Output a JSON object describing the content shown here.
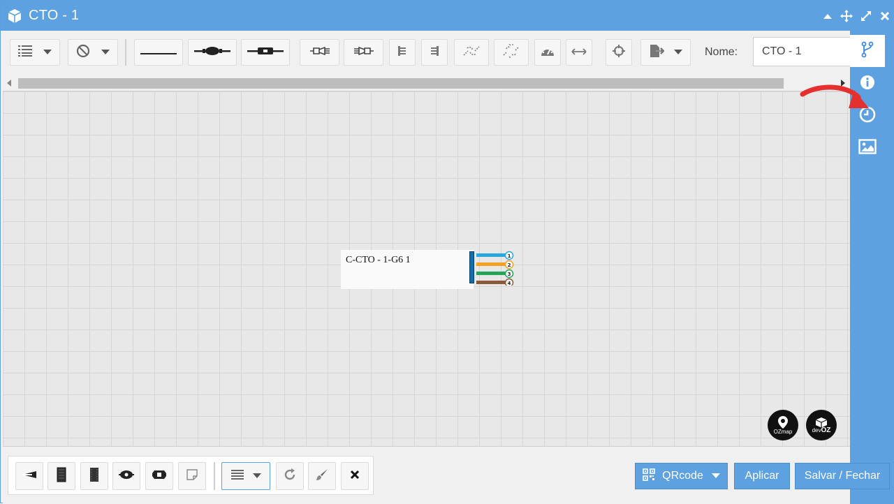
{
  "window": {
    "title": "CTO - 1",
    "title_icon": "cube-icon",
    "controls": [
      "collapse-up-icon",
      "move-icon",
      "expand-icon",
      "close-icon"
    ]
  },
  "toolbar": {
    "list_dropdown_icon": "list-icon",
    "block_dropdown_icon": "block-icon",
    "cable_icon": "cable-line-icon",
    "splice_icon": "splice-icon",
    "connector_icon": "connector-icon",
    "name_label": "Nome:",
    "name_value": "CTO - 1"
  },
  "sidebar": {
    "items": [
      "branch-icon",
      "info-icon",
      "clock-icon",
      "image-icon"
    ],
    "active": "branch-icon"
  },
  "canvas": {
    "node_label": "C-CTO - 1-G6 1",
    "fibers": [
      {
        "num": "1",
        "color": "#29a8e0"
      },
      {
        "num": "2",
        "color": "#f5a020"
      },
      {
        "num": "3",
        "color": "#25a55a"
      },
      {
        "num": "4",
        "color": "#8a5a3a"
      }
    ],
    "logo_ozmap": "OZmap",
    "logo_devoz_small": "dev",
    "logo_devoz_big": "OZ"
  },
  "bottom": {
    "qrcode_label": "QRcode",
    "apply_label": "Aplicar",
    "save_close_label": "Salvar / Fechar"
  },
  "colors": {
    "accent": "#5da1e0",
    "annotation_arrow": "#e53030"
  }
}
